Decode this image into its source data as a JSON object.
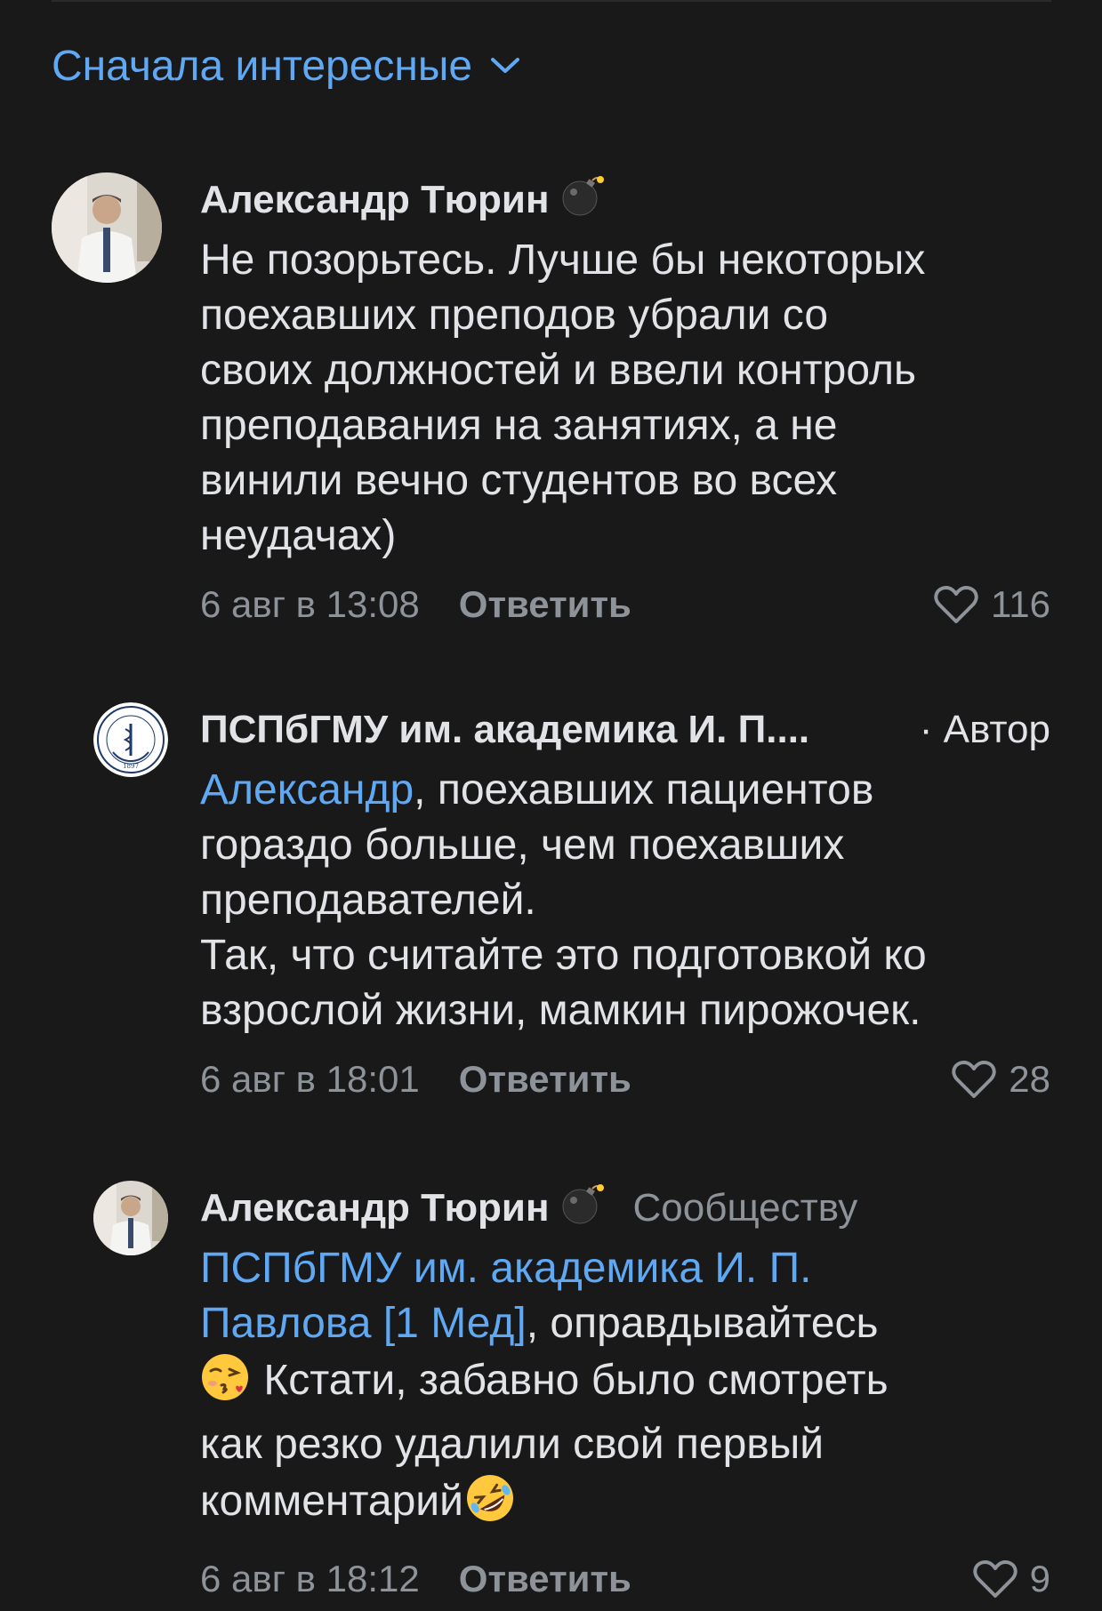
{
  "sort": {
    "label": "Сначала интересные"
  },
  "comments": [
    {
      "author": "Александр Тюрин",
      "lines": [
        "Не позорьтесь. Лучше бы некоторых",
        "поехавших преподов убрали со",
        "своих должностей и ввели контроль",
        "преподавания на занятиях, а не",
        "винили вечно студентов во всех",
        "неудачах)"
      ],
      "date": "6 авг в 13:08",
      "reply": "Ответить",
      "likes": "116"
    },
    {
      "author": "ПСПбГМУ  им. академика И. П....",
      "tag": "· Автор",
      "mention": "Александр",
      "first_rest": ", поехавших пациентов",
      "lines": [
        "гораздо больше, чем поехавших",
        "преподавателей.",
        "Так, что считайте это подготовкой ко",
        "взрослой жизни, мамкин пирожочек."
      ],
      "date": "6 авг в 18:01",
      "reply": "Ответить",
      "likes": "28"
    },
    {
      "author": "Александр Тюрин",
      "target": "Сообществу",
      "mention_line1": "ПСПбГМУ  им. академика И. П.",
      "mention_line2": "Павлова [1 Мед]",
      "line2_rest": ", оправдывайтесь",
      "line3": "Кстати, забавно было смотреть",
      "line4": "как резко удалили свой первый",
      "line5": "комментарий",
      "date": "6 авг в 18:12",
      "reply": "Ответить",
      "likes": "9"
    }
  ],
  "colors": {
    "background": "#19191a",
    "text": "#e1e3e6",
    "secondary": "#8e9399",
    "link": "#5fa8f4"
  },
  "icons": [
    "chevron-down-icon",
    "bomb-icon",
    "heart-icon",
    "kiss-emoji-icon",
    "rofl-emoji-icon"
  ]
}
